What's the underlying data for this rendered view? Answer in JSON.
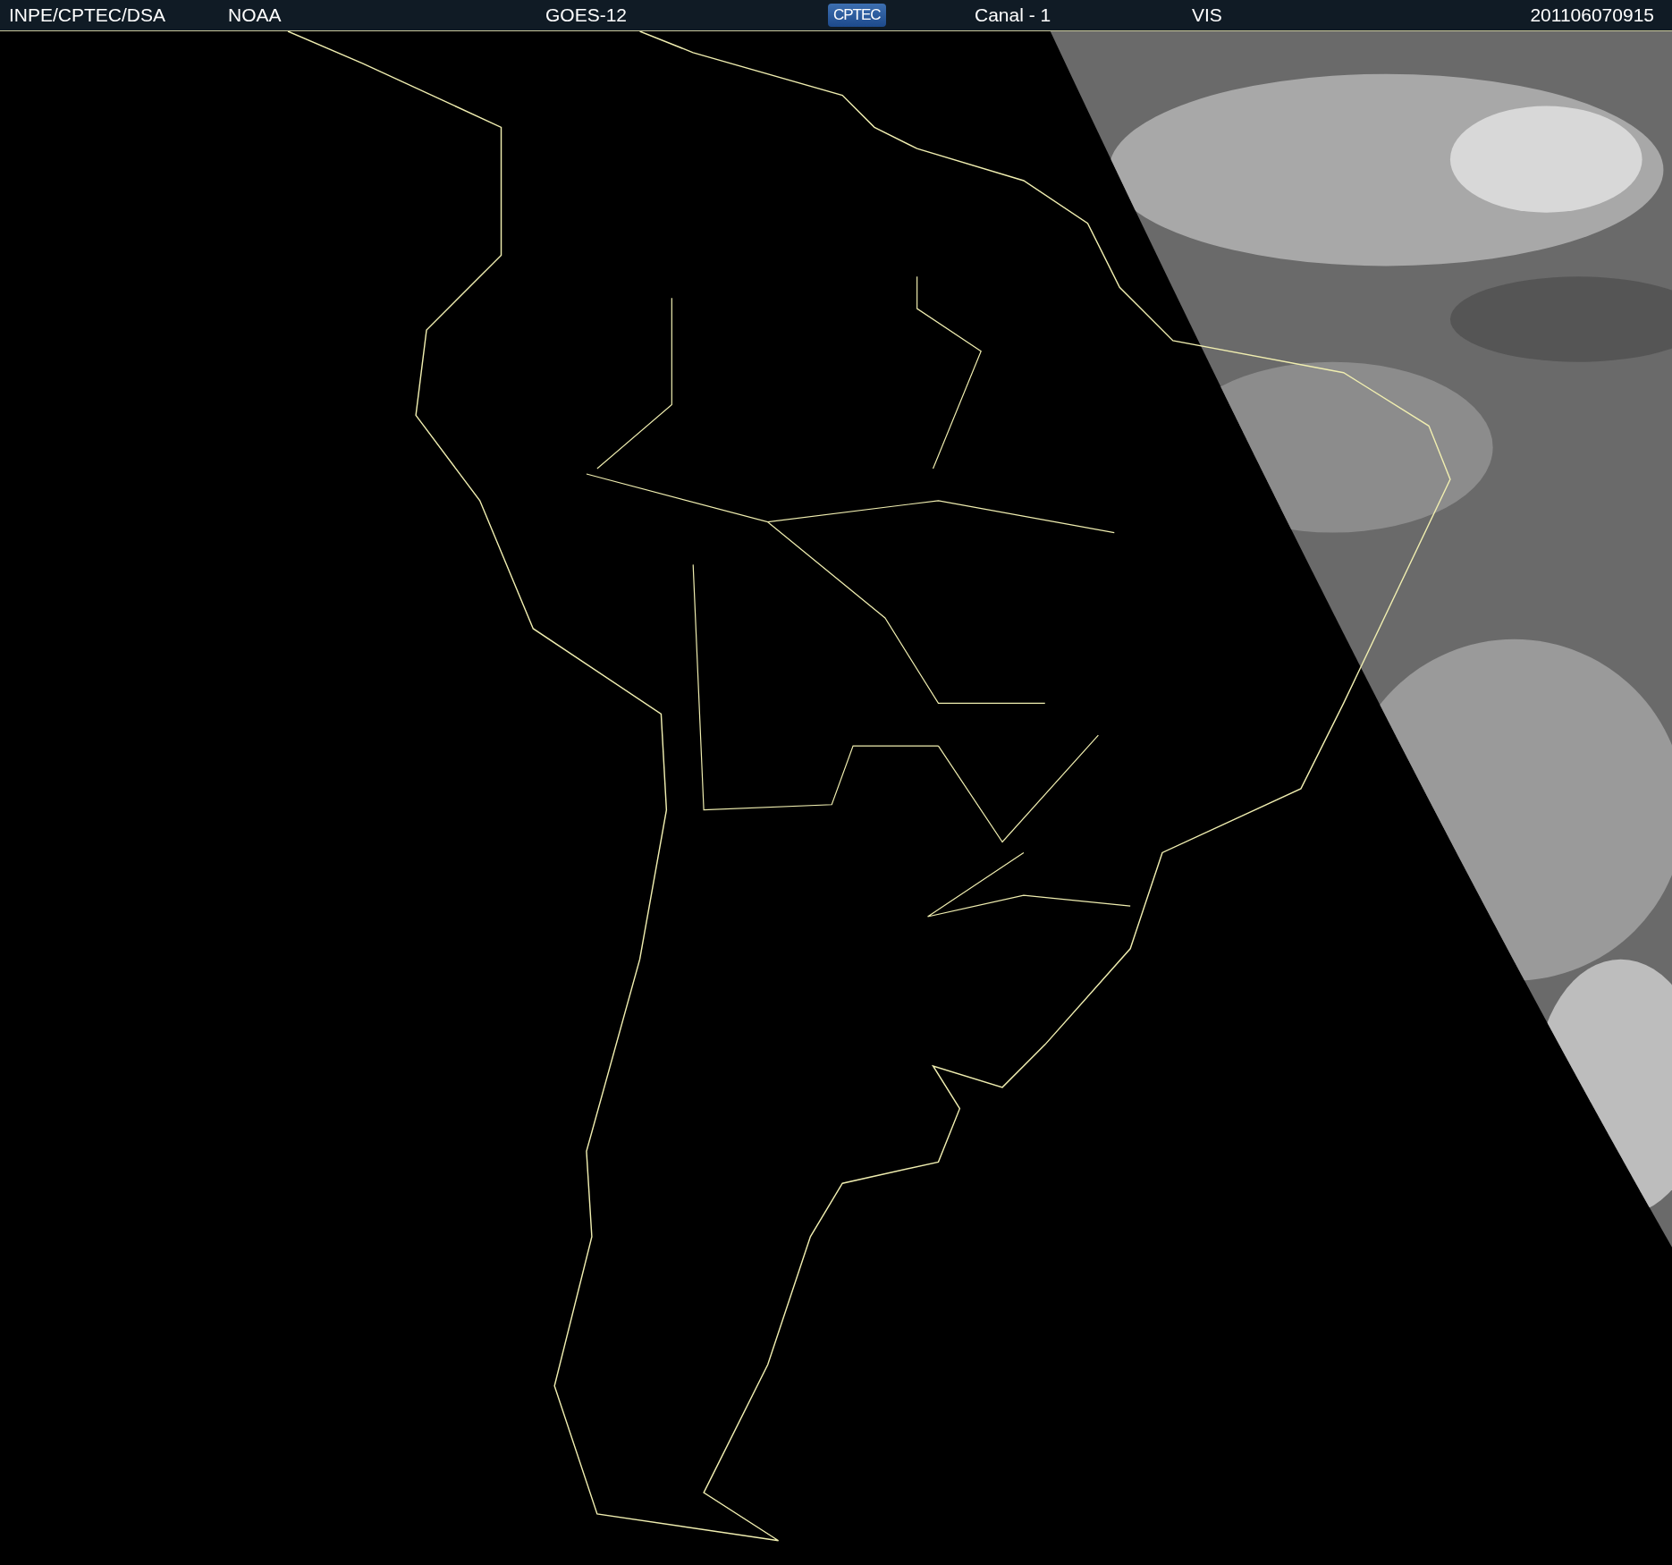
{
  "header": {
    "source": "INPE/CPTEC/DSA",
    "agency": "NOAA",
    "satellite": "GOES-12",
    "logo": "CPTEC",
    "channel": "Canal - 1",
    "band": "VIS",
    "timestamp": "201106070915"
  }
}
